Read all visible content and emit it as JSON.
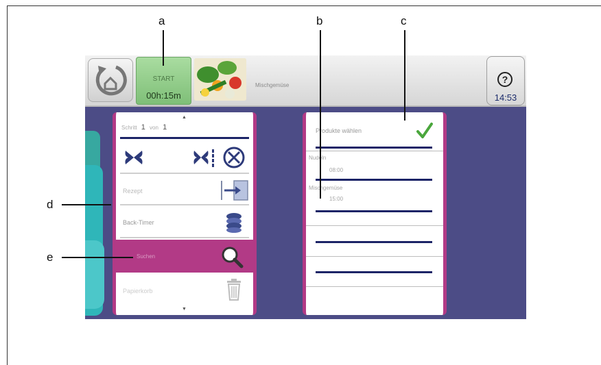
{
  "callouts": {
    "a": "a",
    "b": "b",
    "c": "c",
    "d": "d",
    "e": "e"
  },
  "topbar": {
    "home_icon": "home-rotate-icon",
    "start_label": "START",
    "start_time": "00h:15m",
    "program_name": "Mischgemüse",
    "help_symbol": "?",
    "clock": "14:53"
  },
  "left_panel": {
    "step_label": "Schritt",
    "step_current": "1",
    "step_of": "von",
    "step_total": "1",
    "fan_icons": [
      "fan-icon",
      "fan-speed-icon",
      "circulation-icon"
    ],
    "item_text_1": "Rezept",
    "item_icon_1": "transfer-icon",
    "item_text_2": "Back-Timer",
    "item_icon_2": "stack-icon",
    "item_text_3": "Suchen",
    "item_icon_3": "search-icon",
    "item_text_4": "Papierkorb",
    "item_icon_4": "trash-icon",
    "scroll_up": "▲",
    "scroll_down": "▼"
  },
  "right_panel": {
    "header": "Produkte wählen",
    "confirm_icon": "checkmark-icon",
    "entries": [
      {
        "name": "Nudeln",
        "time": "08:00"
      },
      {
        "name": "Mischgemüse",
        "time": "15:00"
      }
    ]
  },
  "colors": {
    "accent_magenta": "#b23a86",
    "screen_bg": "#4c4c86",
    "start_green": "#8fcf88",
    "teal": "#2fb6b9",
    "navy": "#1c2467",
    "check_green": "#4aa63c"
  }
}
